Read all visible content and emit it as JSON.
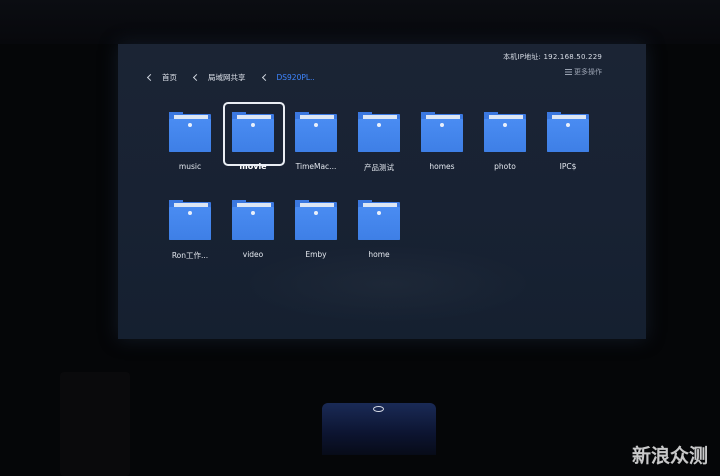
{
  "header": {
    "ip_label": "本机IP地址: 192.168.50.229",
    "more_label": "更多操作"
  },
  "breadcrumb": [
    {
      "label": "首页"
    },
    {
      "label": "局域网共享"
    },
    {
      "label": "DS920PL..",
      "active": true
    }
  ],
  "folders": [
    {
      "name": "music"
    },
    {
      "name": "movie",
      "selected": true
    },
    {
      "name": "TimeMac..."
    },
    {
      "name": "产品测试"
    },
    {
      "name": "homes"
    },
    {
      "name": "photo"
    },
    {
      "name": "IPC$"
    },
    {
      "name": "Ron工作..."
    },
    {
      "name": "video"
    },
    {
      "name": "Emby"
    },
    {
      "name": "home"
    }
  ],
  "watermark": "新浪众测",
  "colors": {
    "accent": "#3e86ff",
    "folder": "#3e7fe6",
    "screen": "#182233"
  }
}
